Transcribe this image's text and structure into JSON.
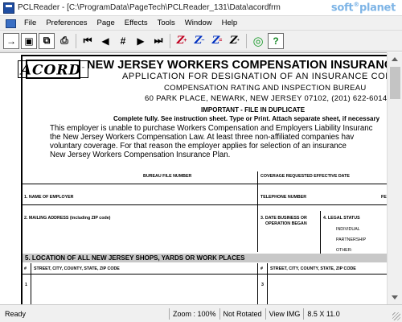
{
  "window": {
    "title": "PCLReader - [C:\\ProgramData\\PageTech\\PCLReader_131\\Data\\acordfrm",
    "watermark": "softplanet.com"
  },
  "menu": {
    "items": [
      "File",
      "Preferences",
      "Page",
      "Effects",
      "Tools",
      "Window",
      "Help"
    ]
  },
  "toolbar": {
    "buttons": [
      {
        "name": "open-icon",
        "glyph": "→"
      },
      {
        "name": "save-icon",
        "glyph": "▣"
      },
      {
        "name": "copy-icon",
        "glyph": "⧉"
      },
      {
        "name": "print-icon",
        "glyph": "⎙"
      },
      {
        "name": "first-page-icon",
        "glyph": "⏮"
      },
      {
        "name": "prev-page-icon",
        "glyph": "◀"
      },
      {
        "name": "goto-page-icon",
        "glyph": "#"
      },
      {
        "name": "next-page-icon",
        "glyph": "▶"
      },
      {
        "name": "last-page-icon",
        "glyph": "⏭"
      },
      {
        "name": "zoom-in-icon",
        "glyph": "Z"
      },
      {
        "name": "zoom-out-icon",
        "glyph": "Z"
      },
      {
        "name": "zoom-width-icon",
        "glyph": "Z"
      },
      {
        "name": "zoom-page-icon",
        "glyph": "Z"
      },
      {
        "name": "record-icon",
        "glyph": "◎"
      },
      {
        "name": "help-icon",
        "glyph": "?"
      }
    ]
  },
  "document": {
    "logo": "ACORD",
    "title": "NEW JERSEY WORKERS COMPENSATION INSURANC",
    "subtitle": "APPLICATION FOR DESIGNATION OF AN INSURANCE COMPANY",
    "bureau_name": "COMPENSATION RATING AND INSPECTION BUREAU",
    "bureau_address": "60 PARK PLACE, NEWARK, NEW JERSEY 07102, (201) 622-6014",
    "important": "IMPORTANT - FILE IN DUPLICATE",
    "instructions": "Complete fully. See instruction sheet. Type or Print. Attach separate sheet, if necessary",
    "intro_lines": [
      "This employer is unable to purchase Workers Compensation and Employers Liability Insuranc",
      "the New Jersey Workers Compensation Law. At least three non-affiliated companies hav",
      "voluntary coverage. For that reason the employer applies for selection of an insurance",
      "New Jersey Workers Compensation Insurance Plan."
    ],
    "fields": {
      "bureau_file_number": "BUREAU FILE NUMBER",
      "coverage_date": "COVERAGE REQUESTED EFFECTIVE DATE",
      "employer_name": "1. NAME OF EMPLOYER",
      "telephone": "TELEPHONE NUMBER",
      "fe": "FE",
      "mailing_address": "2. MAILING ADDRESS (including ZIP code)",
      "date_business": "3. DATE BUSINESS OR",
      "operation_began": "OPERATION BEGAN",
      "legal_status": "4. LEGAL STATUS",
      "individual": "INDIVIDUAL",
      "partnership": "PARTNERSHIP",
      "other": "OTHER:",
      "section5": "5. LOCATION OF ALL NEW JERSEY SHOPS, YARDS OR WORK PLACES",
      "hash_left": "#",
      "street_left": "STREET, CITY, COUNTY, STATE, ZIP CODE",
      "hash_right": "#",
      "street_right": "STREET, CITY, COUNTY, STATE, ZIP CODE",
      "row1": "1",
      "row3": "3"
    }
  },
  "status": {
    "ready": "Ready",
    "zoom": "Zoom : 100%",
    "rotation": "Not Rotated",
    "view": "View IMG",
    "size": "8.5 X 11.0"
  }
}
